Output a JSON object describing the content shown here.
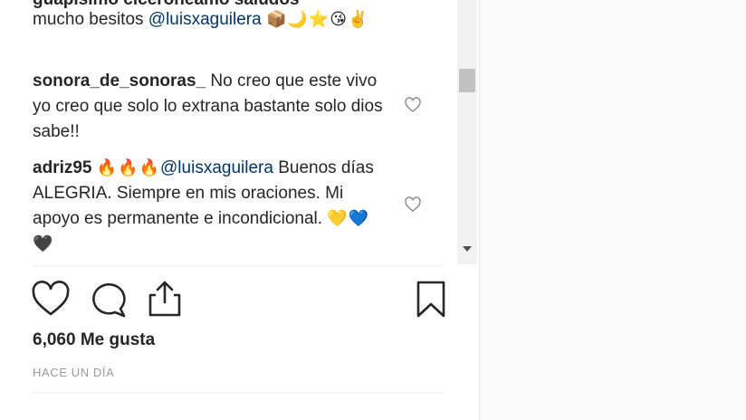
{
  "comments": {
    "cut_off_text": "guapisimo ciceroneamo saludos",
    "first": {
      "text": "mucho besitos ",
      "mention": "@luisxaguilera",
      "emoji": "📦🌙⭐😘✌️"
    },
    "items": [
      {
        "user": "sonora_de_sonoras_",
        "text": "No creo que este vivo yo creo que solo lo extrana bastante solo dios sabe!!"
      },
      {
        "user": "adriz95",
        "emoji": "🔥🔥🔥",
        "mention": "@luisxaguilera",
        "text": "Buenos días ALEGRIA. Siempre en mis oraciones. Mi apoyo es permanente e incondicional.",
        "emoji_end": "💛💙🖤"
      }
    ]
  },
  "actions": {
    "like_icon": "heart-outline-icon",
    "comment_icon": "speech-bubble-icon",
    "share_icon": "share-upload-icon",
    "save_icon": "bookmark-icon"
  },
  "likes": "6,060 Me gusta",
  "time": "HACE UN DÍA",
  "colors": {
    "mention": "#003569",
    "text": "#262626",
    "muted": "#999999"
  }
}
